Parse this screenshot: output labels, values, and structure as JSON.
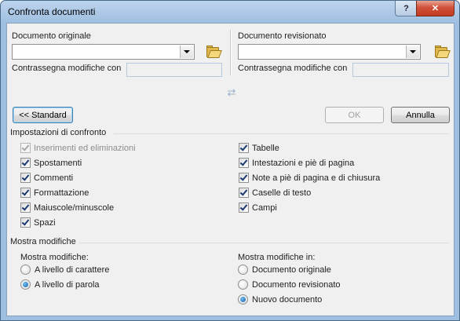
{
  "window": {
    "title": "Confronta documenti",
    "help_label": "?",
    "close_label": "✕"
  },
  "original": {
    "label": "Documento originale",
    "value": "",
    "mark_label": "Contrassegna modifiche con",
    "mark_value": ""
  },
  "revised": {
    "label": "Documento revisionato",
    "value": "",
    "mark_label": "Contrassegna modifiche con",
    "mark_value": ""
  },
  "icons": {
    "browse": "folder-open-icon",
    "swap": "swap-arrows-icon",
    "dropdown": "chevron-down-icon"
  },
  "swap_glyph": "⇄",
  "buttons": {
    "standard": "<< Standard",
    "ok": "OK",
    "cancel": "Annulla"
  },
  "compare_settings": {
    "title": "Impostazioni di confronto",
    "left": [
      {
        "label": "Inserimenti ed eliminazioni",
        "checked": true,
        "disabled": true
      },
      {
        "label": "Spostamenti",
        "checked": true,
        "disabled": false
      },
      {
        "label": "Commenti",
        "checked": true,
        "disabled": false
      },
      {
        "label": "Formattazione",
        "checked": true,
        "disabled": false
      },
      {
        "label": "Maiuscole/minuscole",
        "checked": true,
        "disabled": false
      },
      {
        "label": "Spazi",
        "checked": true,
        "disabled": false
      }
    ],
    "right": [
      {
        "label": "Tabelle",
        "checked": true,
        "disabled": false
      },
      {
        "label": "Intestazioni e piè di pagina",
        "checked": true,
        "disabled": false
      },
      {
        "label": "Note a piè di pagina e di chiusura",
        "checked": true,
        "disabled": false
      },
      {
        "label": "Caselle di testo",
        "checked": true,
        "disabled": false
      },
      {
        "label": "Campi",
        "checked": true,
        "disabled": false
      }
    ]
  },
  "show_changes": {
    "title": "Mostra modifiche",
    "level_title": "Mostra modifiche:",
    "level_options": [
      {
        "label": "A livello di carattere",
        "selected": false
      },
      {
        "label": "A livello di parola",
        "selected": true
      }
    ],
    "in_title": "Mostra modifiche in:",
    "in_options": [
      {
        "label": "Documento originale",
        "selected": false
      },
      {
        "label": "Documento revisionato",
        "selected": false
      },
      {
        "label": "Nuovo documento",
        "selected": true
      }
    ]
  }
}
